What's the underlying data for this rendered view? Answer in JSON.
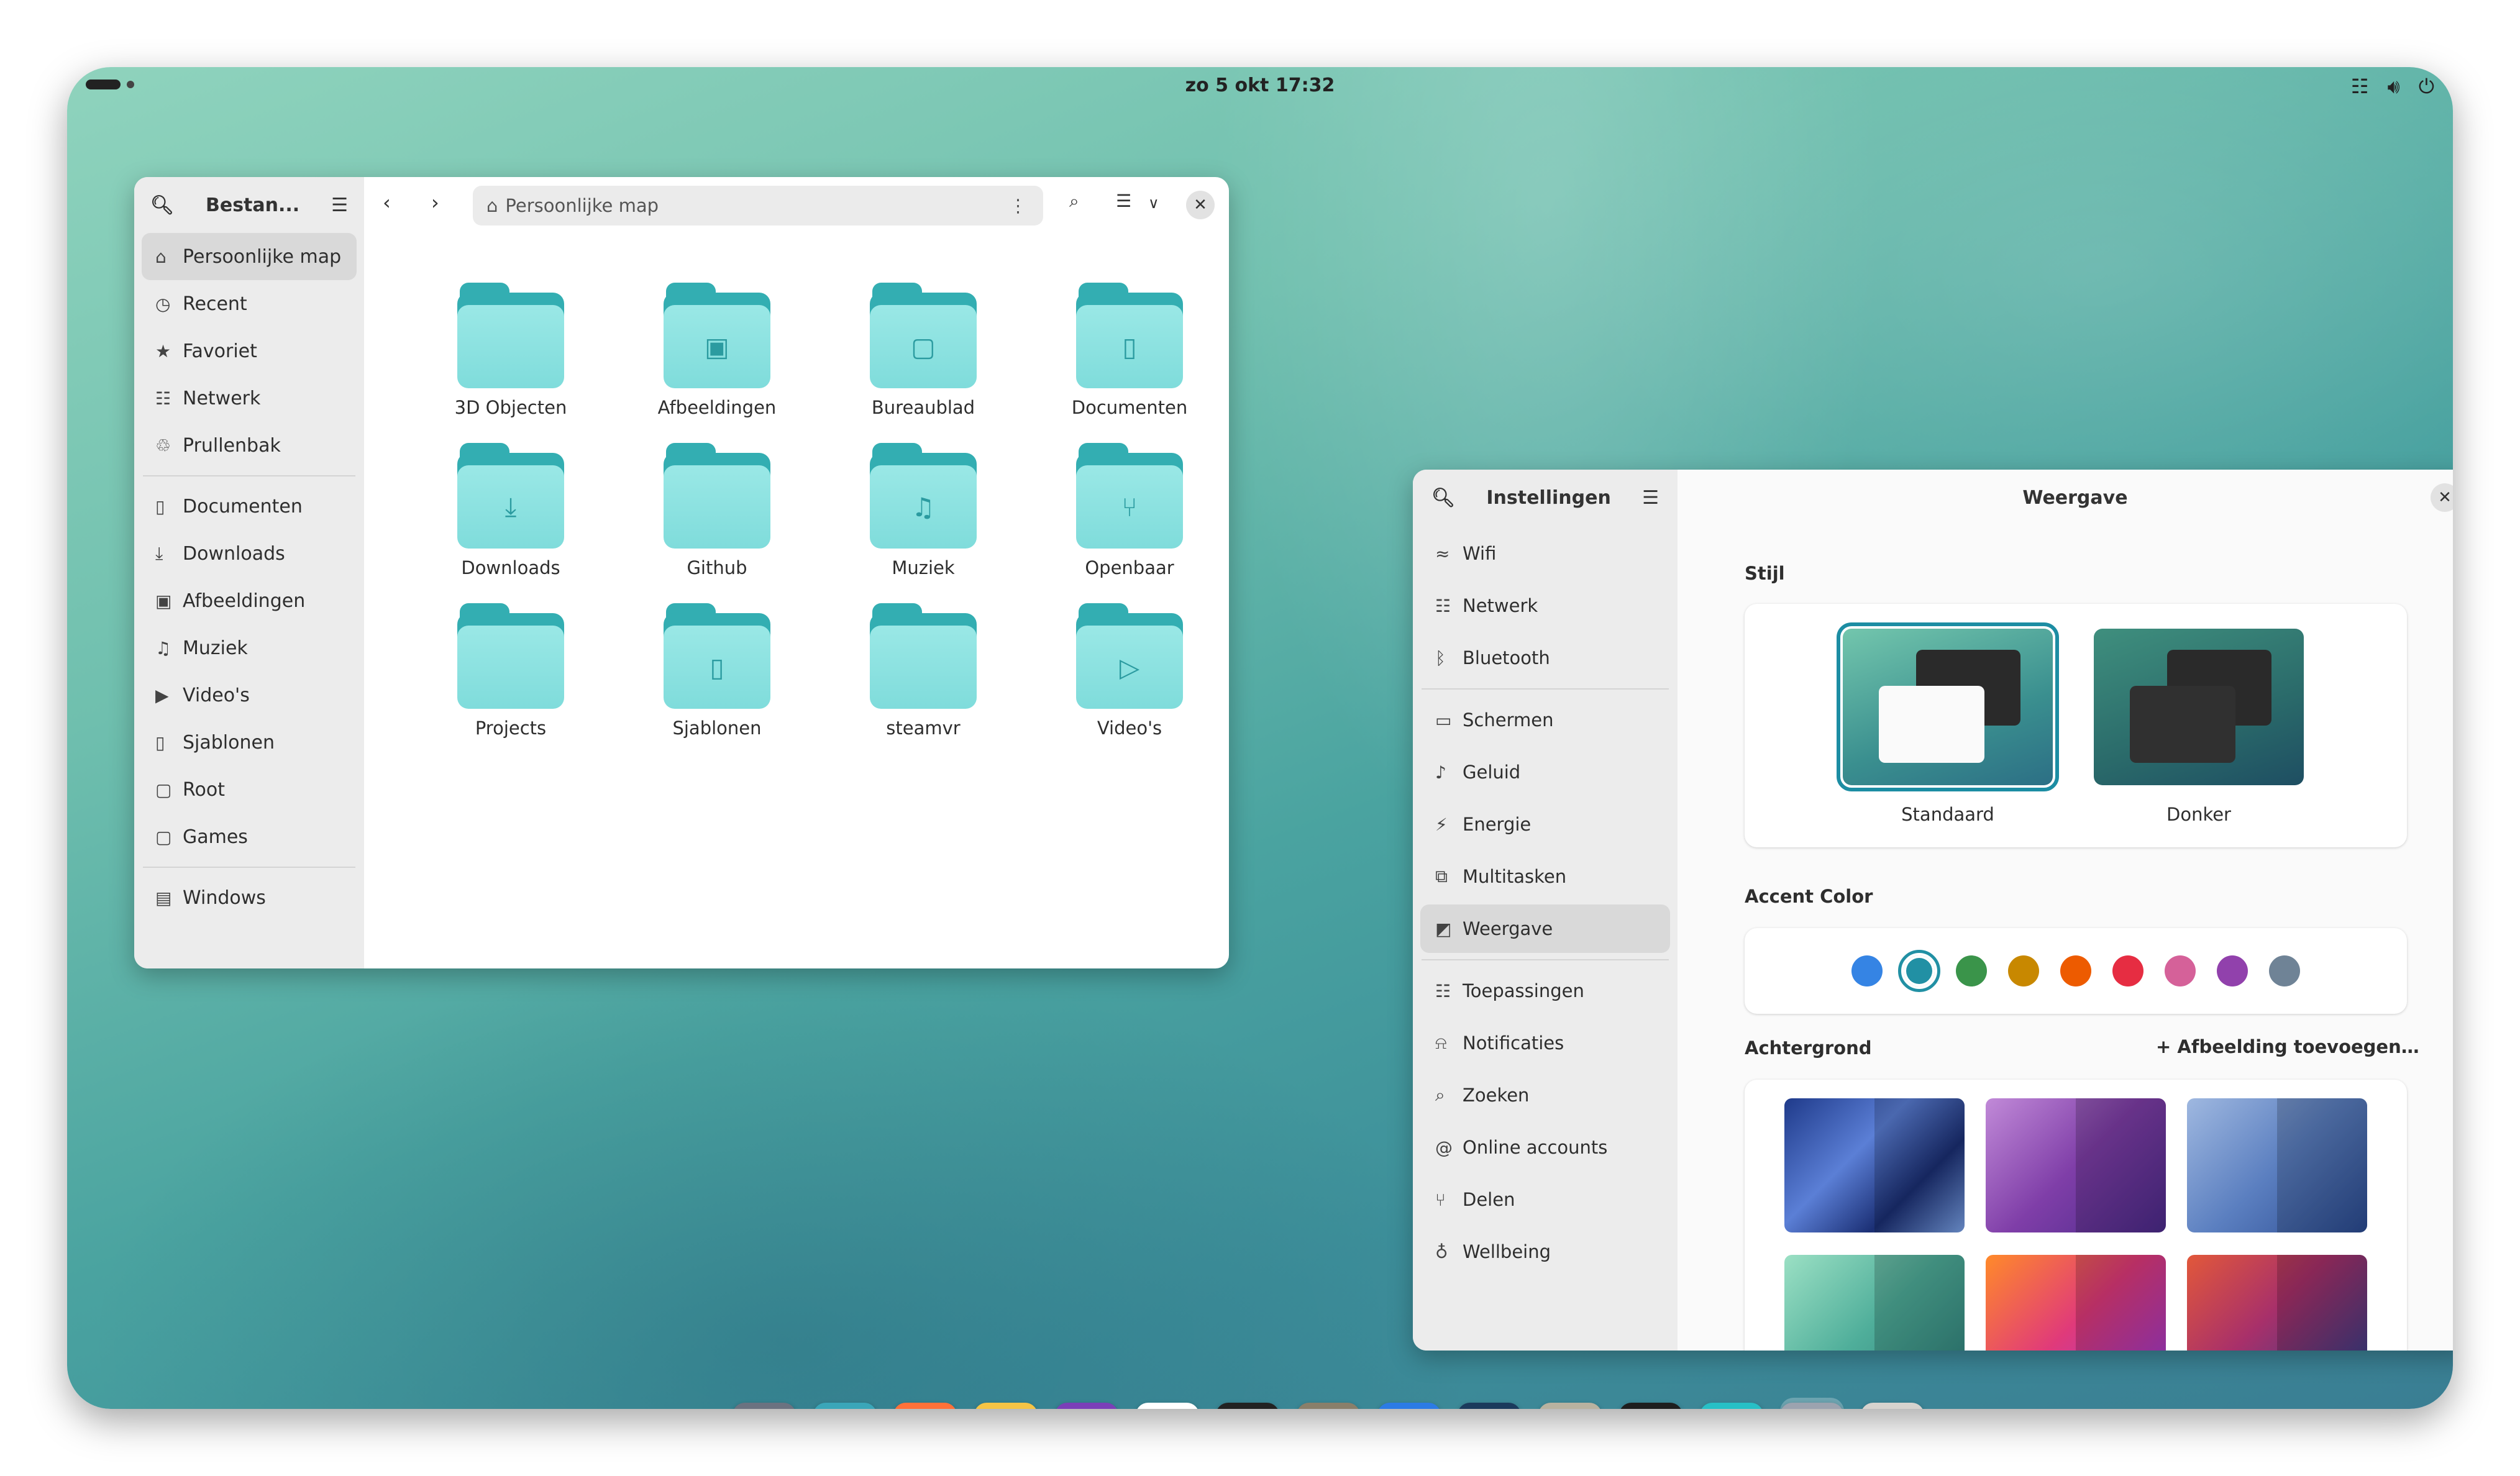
{
  "topbar": {
    "clock": "zo 5 okt  17:32",
    "tray_icons": [
      "network-icon",
      "volume-icon",
      "power-icon"
    ]
  },
  "files_window": {
    "sidebar_title": "Bestan...",
    "path": "Persoonlijke map",
    "sidebar_items": [
      {
        "label": "Persoonlijke map",
        "icon": "home-icon",
        "active": true
      },
      {
        "label": "Recent",
        "icon": "clock-icon"
      },
      {
        "label": "Favoriet",
        "icon": "star-icon"
      },
      {
        "label": "Netwerk",
        "icon": "network-icon"
      },
      {
        "label": "Prullenbak",
        "icon": "trash-icon"
      },
      {
        "label": "Documenten",
        "icon": "document-icon"
      },
      {
        "label": "Downloads",
        "icon": "download-icon"
      },
      {
        "label": "Afbeeldingen",
        "icon": "image-icon"
      },
      {
        "label": "Muziek",
        "icon": "music-icon"
      },
      {
        "label": "Video's",
        "icon": "video-icon"
      },
      {
        "label": "Sjablonen",
        "icon": "document-icon"
      },
      {
        "label": "Root",
        "icon": "folder-icon"
      },
      {
        "label": "Games",
        "icon": "folder-icon"
      },
      {
        "label": "Windows",
        "icon": "drive-icon"
      }
    ],
    "folders": [
      {
        "label": "3D Objecten",
        "emblem": ""
      },
      {
        "label": "Afbeeldingen",
        "emblem": "image-emblem"
      },
      {
        "label": "Bureaublad",
        "emblem": "folder-emblem"
      },
      {
        "label": "Documenten",
        "emblem": "document-emblem"
      },
      {
        "label": "Downloads",
        "emblem": "download-emblem"
      },
      {
        "label": "Github",
        "emblem": ""
      },
      {
        "label": "Muziek",
        "emblem": "music-emblem"
      },
      {
        "label": "Openbaar",
        "emblem": "share-emblem"
      },
      {
        "label": "Projects",
        "emblem": ""
      },
      {
        "label": "Sjablonen",
        "emblem": "document-emblem"
      },
      {
        "label": "steamvr",
        "emblem": ""
      },
      {
        "label": "Video's",
        "emblem": "video-emblem"
      }
    ]
  },
  "settings_window": {
    "sidebar_title": "Instellingen",
    "page_title": "Weergave",
    "sidebar_items": [
      {
        "label": "Wifi",
        "icon": "wifi-icon"
      },
      {
        "label": "Netwerk",
        "icon": "network-icon"
      },
      {
        "label": "Bluetooth",
        "icon": "bluetooth-icon"
      },
      {
        "label": "Schermen",
        "icon": "display-icon"
      },
      {
        "label": "Geluid",
        "icon": "sound-icon"
      },
      {
        "label": "Energie",
        "icon": "battery-icon"
      },
      {
        "label": "Multitasken",
        "icon": "multitask-icon"
      },
      {
        "label": "Weergave",
        "icon": "appearance-icon",
        "active": true
      },
      {
        "label": "Toepassingen",
        "icon": "apps-icon"
      },
      {
        "label": "Notificaties",
        "icon": "bell-icon"
      },
      {
        "label": "Zoeken",
        "icon": "search-icon"
      },
      {
        "label": "Online accounts",
        "icon": "at-icon"
      },
      {
        "label": "Delen",
        "icon": "share-icon"
      },
      {
        "label": "Wellbeing",
        "icon": "wellbeing-icon"
      }
    ],
    "style_section": "Stijl",
    "style_options": [
      {
        "label": "Standaard",
        "selected": true
      },
      {
        "label": "Donker",
        "selected": false
      }
    ],
    "accent_section": "Accent Color",
    "accent_colors": [
      "#3584e4",
      "#2190a4",
      "#3a944a",
      "#c88800",
      "#ed5b00",
      "#e62d42",
      "#d56199",
      "#9141ac",
      "#6f8396"
    ],
    "accent_selected": 1,
    "background_section": "Achtergrond",
    "add_background_label": "Afbeelding toevoegen…"
  },
  "dock": {
    "apps": [
      {
        "name": "launcher-icon",
        "color": "#6b7280",
        "running": false
      },
      {
        "name": "files-icon",
        "color": "#3aa6b9",
        "running": true
      },
      {
        "name": "firefox-icon",
        "color": "#ff7139",
        "running": false
      },
      {
        "name": "mail-icon",
        "color": "#f6c445",
        "running": false
      },
      {
        "name": "calendar-icon",
        "color": "#7b3fb8",
        "running": false
      },
      {
        "name": "inkscape-icon",
        "color": "#ffffff",
        "running": false
      },
      {
        "name": "darktable-icon",
        "color": "#222222",
        "running": false
      },
      {
        "name": "gimp-icon",
        "color": "#8a7f6a",
        "running": false
      },
      {
        "name": "tuba-icon",
        "color": "#2c7be5",
        "running": false
      },
      {
        "name": "steam-icon",
        "color": "#1b3a5c",
        "running": false
      },
      {
        "name": "emulator-icon",
        "color": "#b8b2a0",
        "running": false
      },
      {
        "name": "terminal-icon",
        "color": "#1e1e1e",
        "running": false
      },
      {
        "name": "store-icon",
        "color": "#27c0c6",
        "running": false
      },
      {
        "name": "settings-icon",
        "color": "#9ca3af",
        "running": true
      },
      {
        "name": "trash-icon",
        "color": "#d6d3ce",
        "running": false
      }
    ]
  }
}
